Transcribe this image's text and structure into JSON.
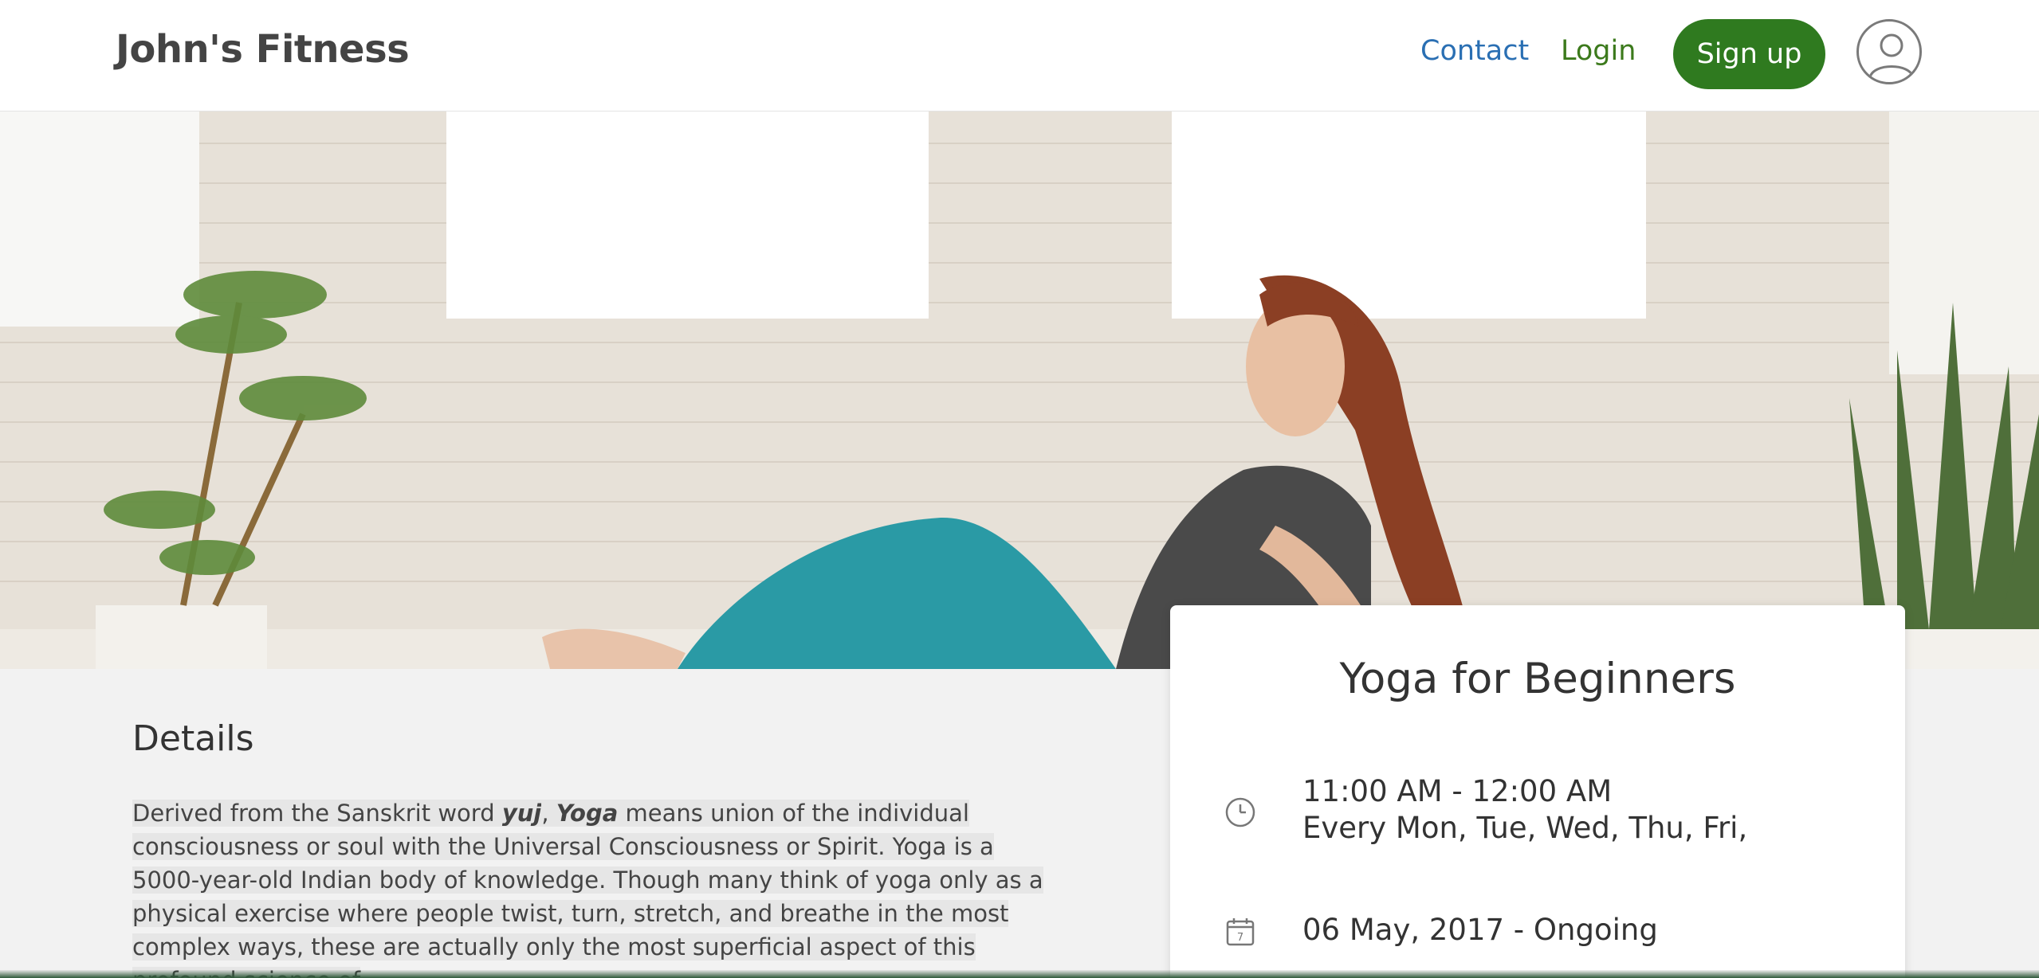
{
  "header": {
    "brand": "John's Fitness",
    "nav": {
      "contact": "Contact",
      "login": "Login",
      "signup": "Sign up"
    }
  },
  "details": {
    "title": "Details",
    "text": {
      "p1": "Derived from the Sanskrit word ",
      "yuj": "yuj",
      "comma": ", ",
      "yoga": "Yoga",
      "p2": " means union of the individual consciousness or soul with the Universal Consciousness or Spirit. Yoga is a 5000-year-old Indian body of knowledge. Though many think of yoga only as a physical exercise where people twist, turn, stretch, and breathe in the most complex ways, these are actually only the most superficial aspect of this profound science of"
    }
  },
  "class_card": {
    "title": "Yoga for Beginners",
    "time": "11:00 AM - 12:00 AM",
    "days": "Every Mon, Tue, Wed, Thu, Fri,",
    "date_range": "06 May, 2017 - Ongoing",
    "icons": {
      "time": "clock-icon",
      "date": "calendar-icon"
    }
  },
  "colors": {
    "brand_text": "#444444",
    "contact_link": "#2a6fb3",
    "login_link": "#3c7a1c",
    "signup_button": "#2f7a1f",
    "page_background": "#f2f2f2"
  }
}
